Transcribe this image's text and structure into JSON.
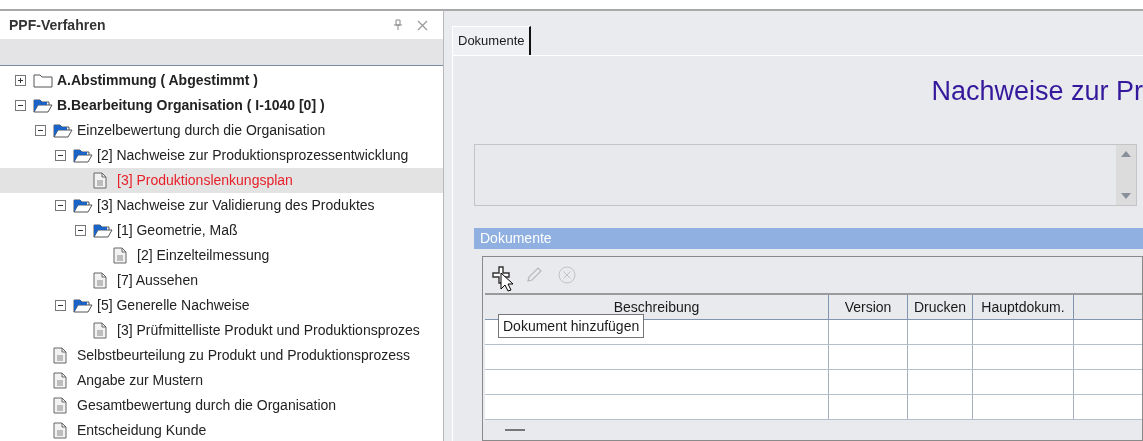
{
  "panel": {
    "title": "PPF-Verfahren"
  },
  "tree": [
    {
      "kind": "folder",
      "label": "A.Abstimmung ( Abgestimmt )",
      "bold": true,
      "expanded": false,
      "selected": false
    },
    {
      "kind": "folder",
      "label": "B.Bearbeitung Organisation  ( I-1040 [0] )",
      "bold": true,
      "expanded": true,
      "selected": false,
      "children": [
        {
          "kind": "folder",
          "label": "Einzelbewertung durch die Organisation",
          "expanded": true,
          "selected": false,
          "children": [
            {
              "kind": "folder",
              "label": "[2] Nachweise zur Produktionsprozessentwicklung",
              "expanded": true,
              "selected": false,
              "children": [
                {
                  "kind": "document",
                  "label": "[3] Produktionslenkungsplan",
                  "selected": true
                }
              ]
            },
            {
              "kind": "folder",
              "label": "[3] Nachweise zur Validierung des Produktes",
              "expanded": true,
              "selected": false,
              "children": [
                {
                  "kind": "folder",
                  "label": "[1] Geometrie, Maß",
                  "expanded": true,
                  "selected": false,
                  "children": [
                    {
                      "kind": "document",
                      "label": "[2] Einzelteilmessung",
                      "selected": false
                    }
                  ]
                },
                {
                  "kind": "document",
                  "label": "[7] Aussehen",
                  "selected": false
                }
              ]
            },
            {
              "kind": "folder",
              "label": "[5] Generelle Nachweise",
              "expanded": true,
              "selected": false,
              "children": [
                {
                  "kind": "document",
                  "label": "[3] Prüfmittelliste Produkt und Produktionsprozes",
                  "selected": false
                }
              ]
            }
          ]
        },
        {
          "kind": "document",
          "label": "Selbstbeurteilung zu Produkt und Produktionsprozess",
          "selected": false
        },
        {
          "kind": "document",
          "label": "Angabe zur Mustern",
          "selected": false
        },
        {
          "kind": "document",
          "label": "Gesamtbewertung durch die Organisation",
          "selected": false
        },
        {
          "kind": "document",
          "label": "Entscheidung Kunde",
          "selected": false
        }
      ]
    }
  ],
  "tabs": [
    {
      "label": "Dokumente",
      "selected": true
    }
  ],
  "heading": "Nachweise zur Pr",
  "documents_group": {
    "title": "Dokumente",
    "toolbar": [
      {
        "kind": "add",
        "disabled": false
      },
      {
        "kind": "edit",
        "disabled": true
      },
      {
        "kind": "delete",
        "disabled": true
      }
    ],
    "columns": [
      "Beschreibung",
      "Version",
      "Drucken",
      "Hauptdokum."
    ],
    "tooltip": "Dokument hinzufügen"
  }
}
